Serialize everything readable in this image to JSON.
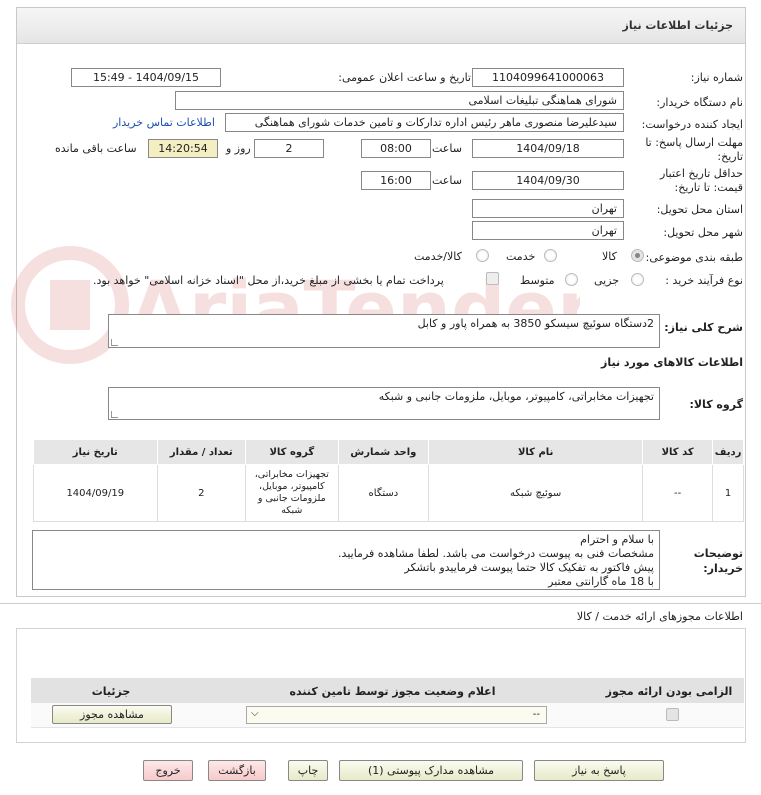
{
  "header": {
    "title": "جزئیات اطلاعات نیاز"
  },
  "fields": {
    "need_number_label": "شماره نیاز:",
    "need_number": "1104099641000063",
    "announce_label": "تاریخ و ساعت اعلان عمومی:",
    "announce_value": "1404/09/15 - 15:49",
    "buyer_label": "نام دستگاه خریدار:",
    "buyer_value": "شورای هماهنگی تبلیغات اسلامی",
    "creator_label": "ایجاد کننده درخواست:",
    "creator_value": "سیدعلیرضا منصوری ماهر رئیس اداره تداركات و تامین خدمات  شورای هماهنگی",
    "contact_link": "اطلاعات تماس خریدار",
    "deadline_label": "مهلت ارسال پاسخ: تا تاریخ:",
    "deadline_date": "1404/09/18",
    "time_label": "ساعت",
    "deadline_time": "08:00",
    "days_value": "2",
    "days_label": "روز و",
    "remaining_time": "14:20:54",
    "remaining_label": "ساعت باقی مانده",
    "validity_label": "حداقل تاریخ اعتبار قیمت: تا تاریخ:",
    "validity_date": "1404/09/30",
    "validity_time": "16:00",
    "province_label": "استان محل تحویل:",
    "province_value": "تهران",
    "city_label": "شهر محل تحویل:",
    "city_value": "تهران",
    "category_label": "طبقه بندی موضوعی:",
    "category_options": [
      "کالا",
      "خدمت",
      "کالا/خدمت"
    ],
    "category_selected": "کالا",
    "process_label": "نوع فرآیند خرید :",
    "process_options": [
      "جزیی",
      "متوسط"
    ],
    "process_selected": "جزیی",
    "payment_note": "پرداخت تمام یا بخشی از مبلغ خرید،از محل \"اسناد خزانه اسلامی\" خواهد بود."
  },
  "summary": {
    "label": "شرح کلی نیاز:",
    "value": "2دستگاه سوئیچ سیسکو 3850 به همراه پاور و کابل"
  },
  "goods_section_title": "اطلاعات کالاهای مورد نیاز",
  "goods_group": {
    "label": "گروه کالا:",
    "value": "تجهیزات مخابراتی، کامپیوتر، موبایل، ملزومات جانبی و شبکه"
  },
  "items_table": {
    "headers": [
      "ردیف",
      "کد کالا",
      "نام کالا",
      "واحد شمارش",
      "گروه کالا",
      "تعداد / مقدار",
      "تاریخ نیاز"
    ],
    "rows": [
      [
        "1",
        "--",
        "سوئیچ شبکه",
        "دستگاه",
        "تجهیزات مخابراتی، کامپیوتر، موبایل، ملزومات جانبی و شبکه",
        "2",
        "1404/09/19"
      ]
    ]
  },
  "buyer_notes": {
    "label": "توضیحات خریدار:",
    "lines": [
      "با سلام و احترام",
      "مشخصات فنی به پیوست درخواست می باشد. لطفا مشاهده فرمایید.",
      "پیش فاکتور به تفکیک کالا حتما پیوست فرماییدو باتشکر",
      "با 18 ماه گارانتی معتبر"
    ]
  },
  "permits": {
    "title": "اطلاعات مجوزهای ارائه خدمت / کالا",
    "headers": [
      "الزامی بودن ارائه مجوز",
      "اعلام وضعیت مجوز توسط تامین کننده",
      "جزئیات"
    ],
    "select_value": "--",
    "view_button": "مشاهده مجوز"
  },
  "buttons": {
    "reply": "پاسخ به نیاز",
    "attachments": "مشاهده مدارک پیوستی (1)",
    "print": "چاپ",
    "back": "بازگشت",
    "exit": "خروج"
  },
  "colors": {
    "accent_link": "#1a4fb5",
    "highlight": "#f4efc2",
    "button_pink": "#f6caca"
  }
}
